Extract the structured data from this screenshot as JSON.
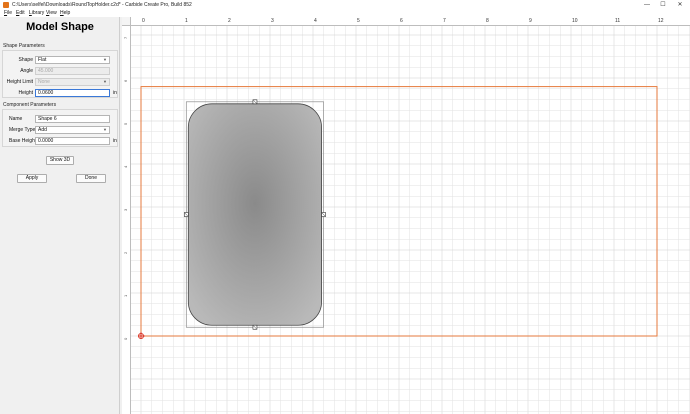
{
  "window": {
    "title": "C:\\Users\\selfel\\Downloads\\RoundTopHolder.c2d* - Carbide Create Pro, Build 852",
    "min_glyph": "—",
    "max_glyph": "☐",
    "close_glyph": "✕"
  },
  "menu": [
    "File",
    "Edit",
    "Library",
    "View",
    "Help"
  ],
  "panel": {
    "title": "Model Shape",
    "shape_section": "Shape Parameters",
    "component_section": "Component Parameters",
    "shape_label": "Shape",
    "shape_value": "Flat",
    "angle_label": "Angle",
    "angle_value": "45.000",
    "height_limit_label": "Height Limit",
    "height_limit_value": "None",
    "height_label": "Height",
    "height_value": "0.0600",
    "height_unit": "in",
    "name_label": "Name",
    "name_value": "Shape 6",
    "merge_type_label": "Merge Type",
    "merge_type_value": "Add",
    "base_height_label": "Base Height",
    "base_height_value": "0.0000",
    "base_height_unit": "in",
    "show_3d_label": "Show 3D",
    "apply_label": "Apply",
    "done_label": "Done",
    "dropdown_glyph": "▼"
  },
  "ruler": {
    "top_labels": [
      "0",
      "1",
      "2",
      "3",
      "4",
      "5",
      "6",
      "7",
      "8",
      "9",
      "10",
      "11",
      "12"
    ],
    "left_labels": [
      "7",
      "6",
      "5",
      "4",
      "3",
      "2",
      "1",
      "0"
    ]
  },
  "colors": {
    "stock_outline": "#e67a3c",
    "grid_line": "#e2e2e2",
    "grid_major": "#cfcfcf",
    "shape_fill_center": "#8a8a8a",
    "shape_fill_edge": "#b9b9b9",
    "origin_marker": "#d9301f",
    "focus": "#3a78d8"
  },
  "canvas": {
    "stock_width_in": 12,
    "stock_height_in": 5.8,
    "shape": {
      "x_in": 1.1,
      "y_in": 0.25,
      "width_in": 3.1,
      "height_in": 5.15,
      "corner_radius_in": 0.55
    }
  }
}
